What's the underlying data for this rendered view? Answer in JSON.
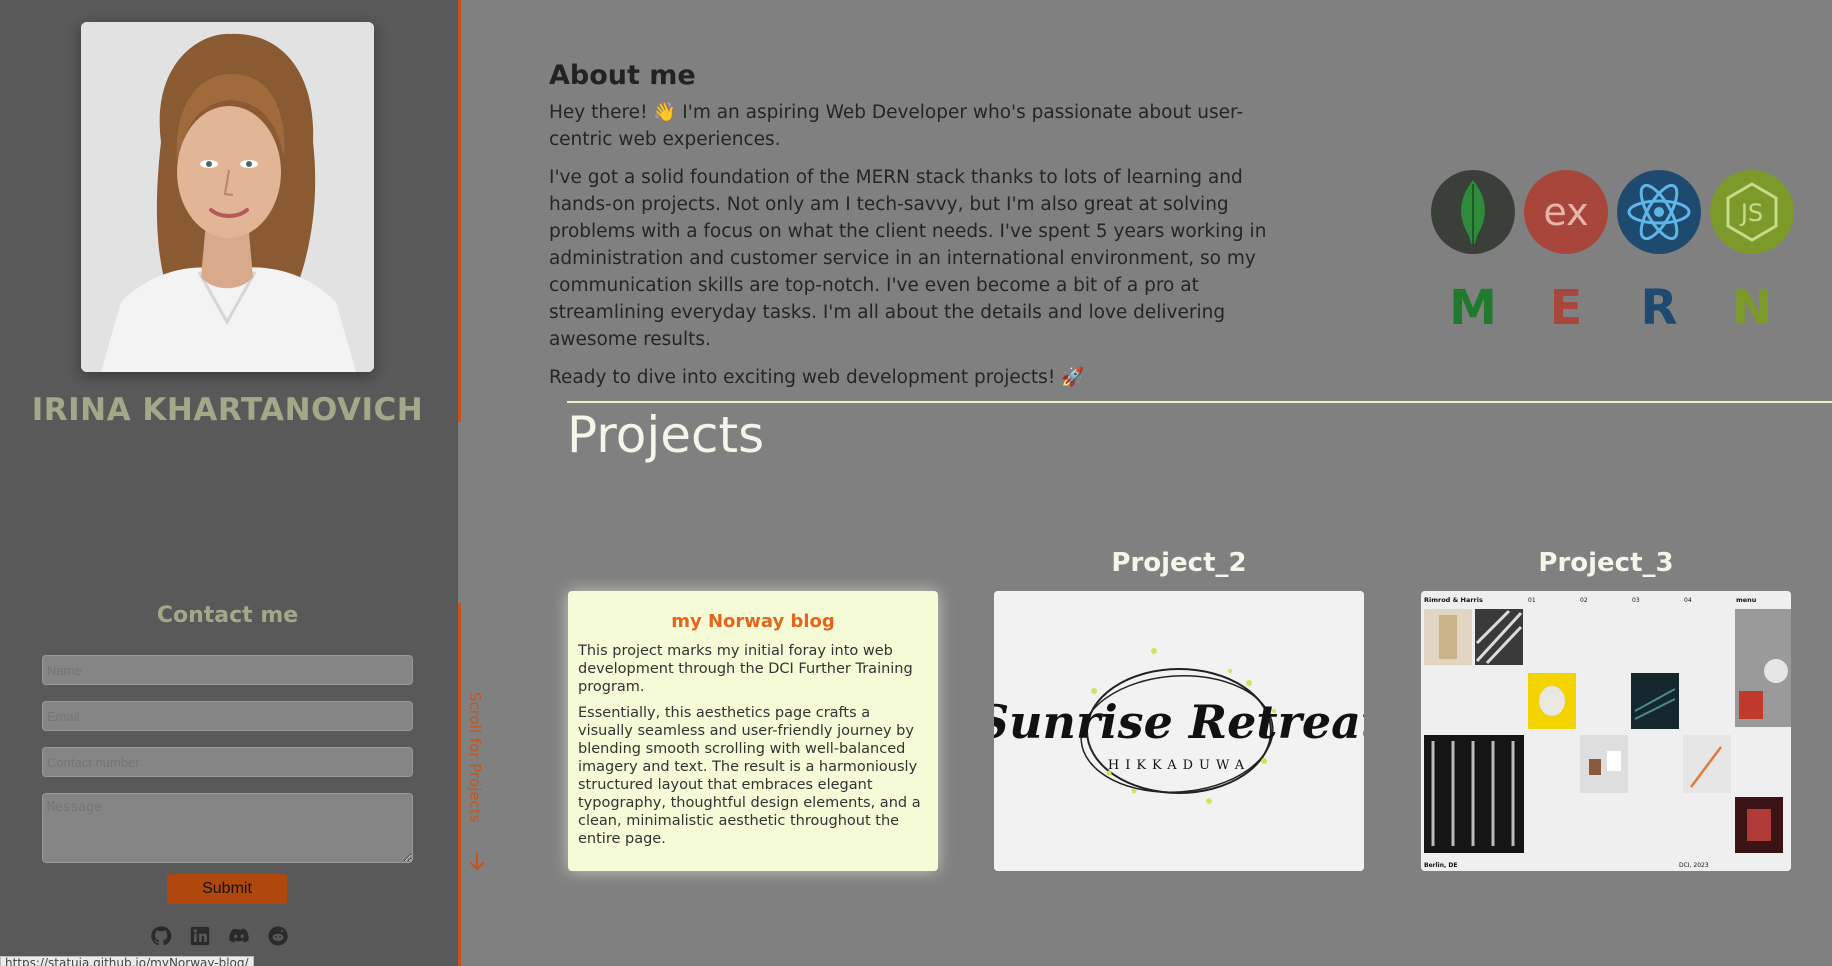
{
  "profile": {
    "name": "IRINA KHARTANOVICH",
    "photo_alt": "profile-photo"
  },
  "contact": {
    "title": "Contact me",
    "name_placeholder": "Name",
    "email_placeholder": "Email",
    "phone_placeholder": "Contact number",
    "message_placeholder": "Message",
    "submit_label": "Submit"
  },
  "socials": [
    "github-icon",
    "linkedin-icon",
    "discord-icon",
    "reddit-icon"
  ],
  "scroll_hint": "Scroll for Projects",
  "about": {
    "title": "About me",
    "p1": "Hey there! 👋 I'm an aspiring Web Developer who's passionate about user-centric web experiences.",
    "p2": "I've got a solid foundation of the MERN stack thanks to lots of learning and hands-on projects. Not only am I tech-savvy, but I'm also great at solving problems with a focus on what the client needs. I've spent 5 years working in administration and customer service in an international environment, so my communication skills are top-notch. I've even become a bit of a pro at streamlining everyday tasks. I'm all about the details and love delivering awesome results.",
    "p3": "Ready to dive into exciting web development projects! 🚀"
  },
  "mern": {
    "letters": [
      "M",
      "E",
      "R",
      "N"
    ],
    "icons": [
      "mongodb-icon",
      "express-icon",
      "react-icon",
      "nodejs-icon"
    ],
    "colors": [
      "#1f7a2e",
      "#a8463c",
      "#1d4a6e",
      "#7c9a2a"
    ],
    "express_text": "ex",
    "node_text": "JS"
  },
  "projects": {
    "title": "Projects",
    "items": [
      {
        "title": "",
        "card_title": "my Norway blog",
        "p1": "This project marks my initial foray into web development through the DCI Further Training program.",
        "p2": "Essentially, this aesthetics page crafts a visually seamless and user-friendly journey by blending smooth scrolling with well-balanced imagery and text. The result is a harmoniously structured layout that embraces elegant typography, thoughtful design elements, and a clean, minimalistic aesthetic throughout the entire page."
      },
      {
        "title": "Project_2",
        "logo_text": "Sunrise Retreat",
        "logo_sub": "HIKKADUWA"
      },
      {
        "title": "Project_3",
        "site_brand": "Rimrod & Harris",
        "site_nav": [
          "01",
          "02",
          "03",
          "04"
        ],
        "site_menu": "menu",
        "site_city": "Berlin, DE",
        "site_date": "DCI, 2023"
      }
    ]
  },
  "status_url": "https://statuia.github.io/myNorway-blog/"
}
